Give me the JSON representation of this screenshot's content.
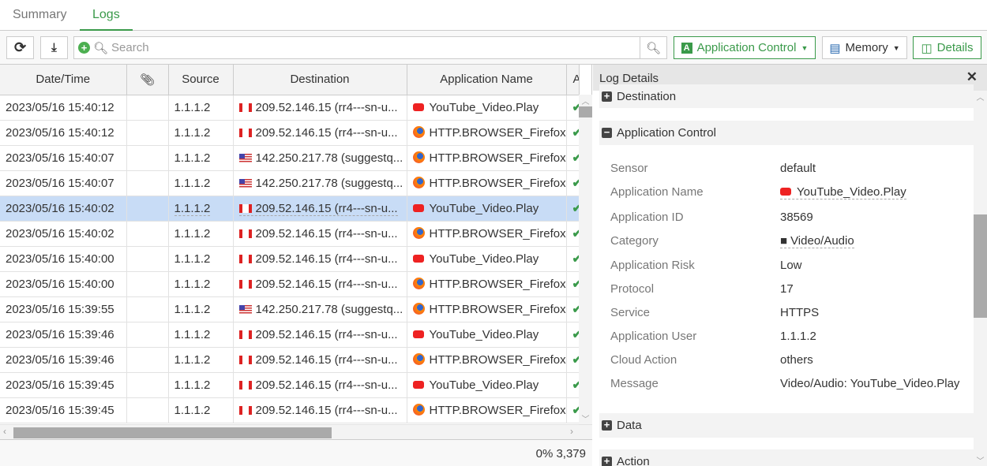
{
  "tabs": [
    {
      "label": "Summary"
    },
    {
      "label": "Logs"
    }
  ],
  "toolbar": {
    "search_placeholder": "Search",
    "app_control": "Application Control",
    "memory": "Memory",
    "details": "Details"
  },
  "table": {
    "headers": [
      "Date/Time",
      "",
      "Source",
      "Destination",
      "Application Name",
      "Act"
    ],
    "rows": [
      {
        "time": "2023/05/16 15:40:12",
        "source": "1.1.1.2",
        "flag": "ca",
        "dest": "209.52.146.15 (rr4---sn-u...",
        "app_icon": "youtube",
        "app": "YouTube_Video.Play"
      },
      {
        "time": "2023/05/16 15:40:12",
        "source": "1.1.1.2",
        "flag": "ca",
        "dest": "209.52.146.15 (rr4---sn-u...",
        "app_icon": "firefox",
        "app": "HTTP.BROWSER_Firefox"
      },
      {
        "time": "2023/05/16 15:40:07",
        "source": "1.1.1.2",
        "flag": "us",
        "dest": "142.250.217.78 (suggestq...",
        "app_icon": "firefox",
        "app": "HTTP.BROWSER_Firefox"
      },
      {
        "time": "2023/05/16 15:40:07",
        "source": "1.1.1.2",
        "flag": "us",
        "dest": "142.250.217.78 (suggestq...",
        "app_icon": "firefox",
        "app": "HTTP.BROWSER_Firefox"
      },
      {
        "time": "2023/05/16 15:40:02",
        "source": "1.1.1.2",
        "flag": "ca",
        "dest": "209.52.146.15 (rr4---sn-u...",
        "app_icon": "youtube",
        "app": "YouTube_Video.Play"
      },
      {
        "time": "2023/05/16 15:40:02",
        "source": "1.1.1.2",
        "flag": "ca",
        "dest": "209.52.146.15 (rr4---sn-u...",
        "app_icon": "firefox",
        "app": "HTTP.BROWSER_Firefox"
      },
      {
        "time": "2023/05/16 15:40:00",
        "source": "1.1.1.2",
        "flag": "ca",
        "dest": "209.52.146.15 (rr4---sn-u...",
        "app_icon": "youtube",
        "app": "YouTube_Video.Play"
      },
      {
        "time": "2023/05/16 15:40:00",
        "source": "1.1.1.2",
        "flag": "ca",
        "dest": "209.52.146.15 (rr4---sn-u...",
        "app_icon": "firefox",
        "app": "HTTP.BROWSER_Firefox"
      },
      {
        "time": "2023/05/16 15:39:55",
        "source": "1.1.1.2",
        "flag": "us",
        "dest": "142.250.217.78 (suggestq...",
        "app_icon": "firefox",
        "app": "HTTP.BROWSER_Firefox"
      },
      {
        "time": "2023/05/16 15:39:46",
        "source": "1.1.1.2",
        "flag": "ca",
        "dest": "209.52.146.15 (rr4---sn-u...",
        "app_icon": "youtube",
        "app": "YouTube_Video.Play"
      },
      {
        "time": "2023/05/16 15:39:46",
        "source": "1.1.1.2",
        "flag": "ca",
        "dest": "209.52.146.15 (rr4---sn-u...",
        "app_icon": "firefox",
        "app": "HTTP.BROWSER_Firefox"
      },
      {
        "time": "2023/05/16 15:39:45",
        "source": "1.1.1.2",
        "flag": "ca",
        "dest": "209.52.146.15 (rr4---sn-u...",
        "app_icon": "youtube",
        "app": "YouTube_Video.Play"
      },
      {
        "time": "2023/05/16 15:39:45",
        "source": "1.1.1.2",
        "flag": "ca",
        "dest": "209.52.146.15 (rr4---sn-u...",
        "app_icon": "firefox",
        "app": "HTTP.BROWSER_Firefox"
      }
    ],
    "selected_index": 4
  },
  "footer": {
    "status": "0% 3,379"
  },
  "details": {
    "title": "Log Details",
    "sections": {
      "destination": "Destination",
      "app_control": "Application Control",
      "data": "Data",
      "action": "Action"
    },
    "fields": [
      {
        "label": "Sensor",
        "value": "default"
      },
      {
        "label": "Application Name",
        "value": "YouTube_Video.Play"
      },
      {
        "label": "Application ID",
        "value": "38569"
      },
      {
        "label": "Category",
        "value": "Video/Audio"
      },
      {
        "label": "Application Risk",
        "value": "Low"
      },
      {
        "label": "Protocol",
        "value": "17"
      },
      {
        "label": "Service",
        "value": "HTTPS"
      },
      {
        "label": "Application User",
        "value": "1.1.1.2"
      },
      {
        "label": "Cloud Action",
        "value": "others"
      },
      {
        "label": "Message",
        "value": "Video/Audio: YouTube_Video.Play"
      }
    ]
  }
}
